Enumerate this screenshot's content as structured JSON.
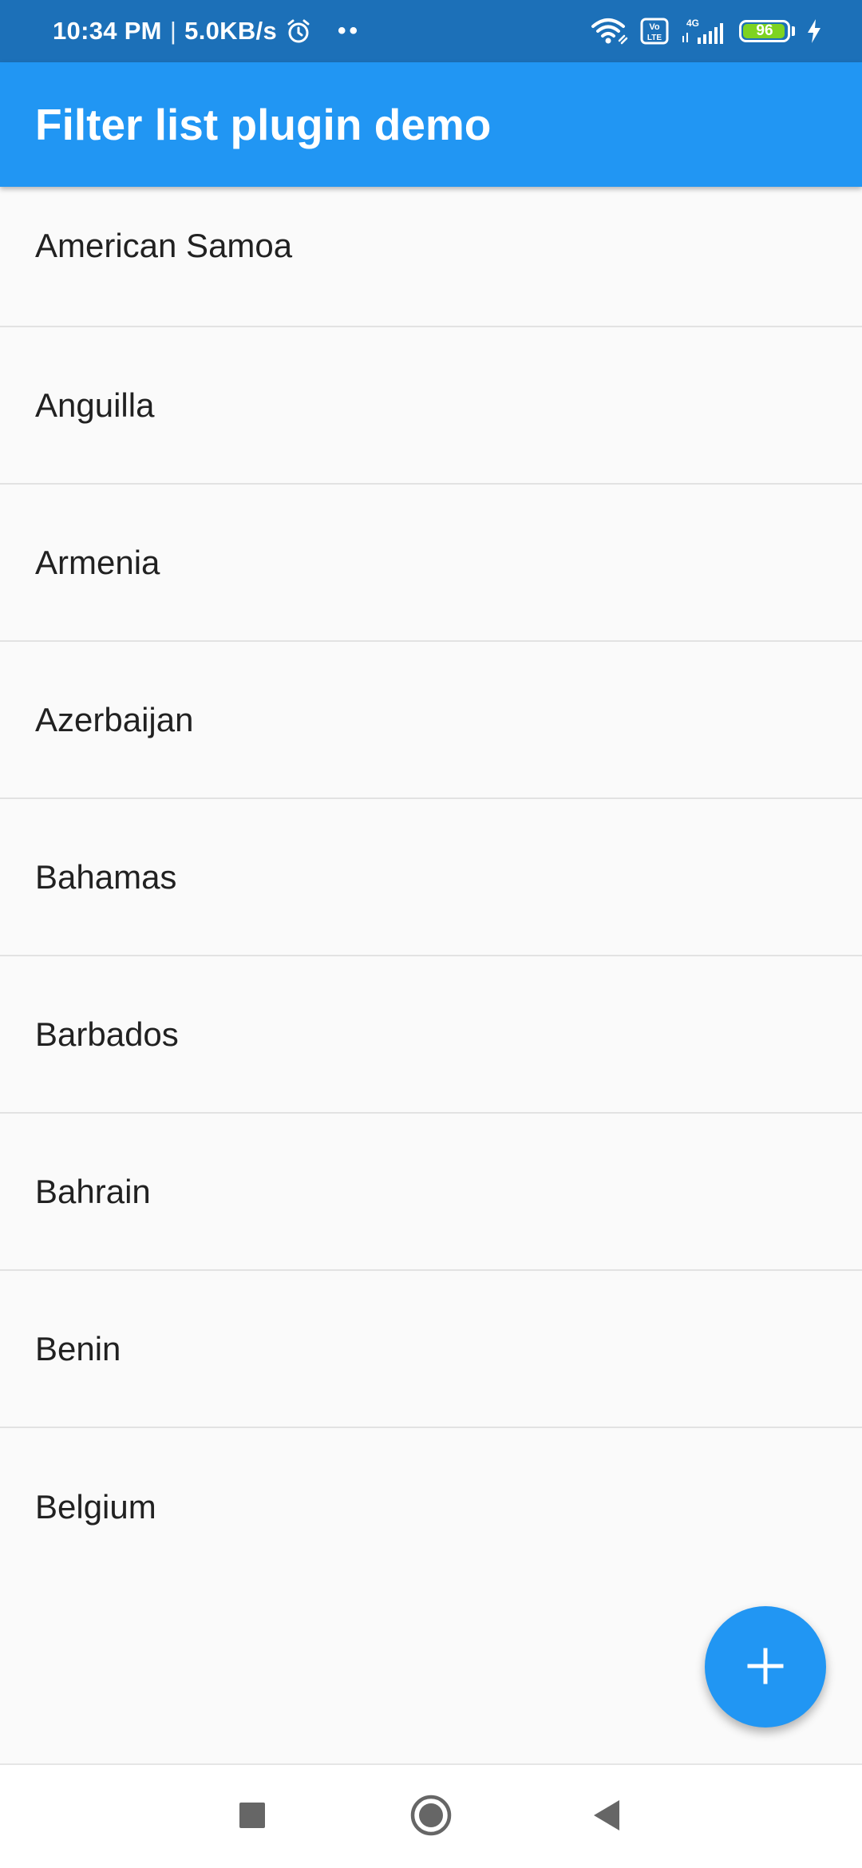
{
  "status_bar": {
    "time": "10:34 PM",
    "separator": "|",
    "net_speed": "5.0KB/s",
    "dots": "••",
    "battery_level": "96",
    "network_type": "4G",
    "volte_label": "Vo LTE",
    "icons": [
      "alarm-icon",
      "wifi-icon",
      "volte-icon",
      "signal-icon",
      "battery-icon",
      "charging-icon"
    ]
  },
  "app_bar": {
    "title": "Filter list plugin demo"
  },
  "countries": [
    "American Samoa",
    "Anguilla",
    "Armenia",
    "Azerbaijan",
    "Bahamas",
    "Barbados",
    "Bahrain",
    "Benin",
    "Belgium"
  ],
  "fab": {
    "icon": "plus-icon"
  },
  "nav_bar": {
    "icons": [
      "recent-apps-icon",
      "home-icon",
      "back-icon"
    ]
  },
  "colors": {
    "status_bar": "#1c70b8",
    "app_bar": "#2196f3",
    "fab": "#2196f3",
    "background": "#fafafa",
    "divider": "#e2e2e2",
    "battery_fill": "#7ed321"
  }
}
